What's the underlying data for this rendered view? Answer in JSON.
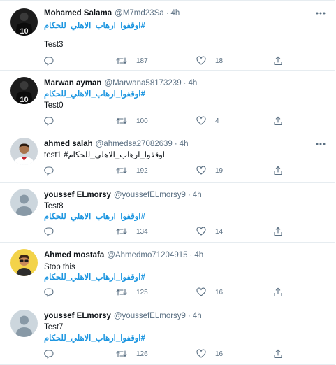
{
  "tweets": [
    {
      "name": "Mohamed Salama",
      "handle": "@M7md23Sa",
      "time": "4h",
      "lines": [
        "#اوقفوا_ارهاب_الاهلي_للحكام",
        "Test3"
      ],
      "retweets": "187",
      "likes": "18",
      "avatar_icon": "player-jersey-avatar-icon"
    },
    {
      "name": "Marwan ayman",
      "handle": "@Marwana58173239",
      "time": "4h",
      "lines": [
        "#اوقفوا_ارهاب_الاهلي_للحكام",
        "Test0"
      ],
      "retweets": "100",
      "likes": "4",
      "avatar_icon": "player-jersey-avatar-icon"
    },
    {
      "name": "ahmed salah",
      "handle": "@ahmedsa27082639",
      "time": "4h",
      "lines": [
        "test1 #اوقفوا_ارهاب_الاهلي_للحكام"
      ],
      "retweets": "192",
      "likes": "19",
      "avatar_icon": "player-photo-avatar-icon"
    },
    {
      "name": "youssef ELmorsy",
      "handle": "@youssefELmorsy9",
      "time": "4h",
      "lines": [
        "Test8",
        "#اوقفوا_ارهاب_الاهلي_للحكام"
      ],
      "retweets": "134",
      "likes": "14",
      "avatar_icon": "default-profile-avatar-icon"
    },
    {
      "name": "Ahmed mostafa",
      "handle": "@Ahmedmo71204915",
      "time": "4h",
      "lines": [
        "Stop this",
        "#اوقفوا_ارهاب_الاهلي_للحكام"
      ],
      "retweets": "125",
      "likes": "16",
      "avatar_icon": "cartoon-avatar-icon"
    },
    {
      "name": "youssef ELmorsy",
      "handle": "@youssefELmorsy9",
      "time": "4h",
      "lines": [
        "Test7",
        "#اوقفوا_ارهاب_الاهلي_للحكام"
      ],
      "retweets": "126",
      "likes": "16",
      "avatar_icon": "default-profile-avatar-icon"
    }
  ],
  "separator": "·",
  "colors": {
    "hashtag": "#1b95e0",
    "secondary_text": "#5b7083",
    "divider": "#e6ecf0"
  }
}
